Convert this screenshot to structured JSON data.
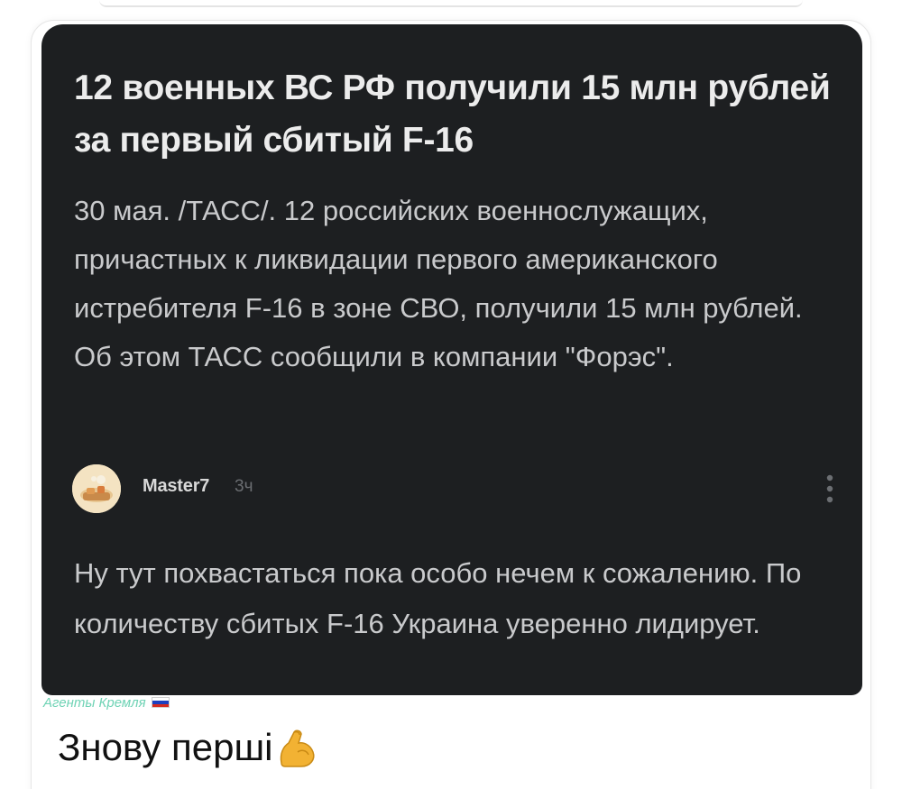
{
  "post": {
    "headline": "12 военных ВС РФ получили 15 млн рублей за первый сбитый F-16",
    "body": "30 мая. /ТАСС/. 12 российских военнослужащих, причастных к ликвидации первого американского истребителя F-16 в зоне СВО, получили 15 млн рублей. Об этом ТАСС сообщили в компании \"Форэс\"."
  },
  "comment": {
    "avatar_icon": "food-avatar-icon",
    "username": "Master7",
    "time": "3ч",
    "menu_icon": "more-vertical-icon",
    "text": "Ну тут похвастаться пока особо нечем к сожалению. По количеству сбитых F-16 Украина уверенно лидирует."
  },
  "watermark": {
    "text": "Агенты Кремля",
    "flag_icon": "russian-flag-icon"
  },
  "caption": {
    "text": "Знову перші",
    "emoji_icon": "flexed-biceps-icon"
  },
  "colors": {
    "card_background": "#1d1f21",
    "headline_text": "#ececec",
    "body_text": "#c9cacc",
    "watermark_text": "#6fd3b5",
    "caption_text": "#111111"
  }
}
